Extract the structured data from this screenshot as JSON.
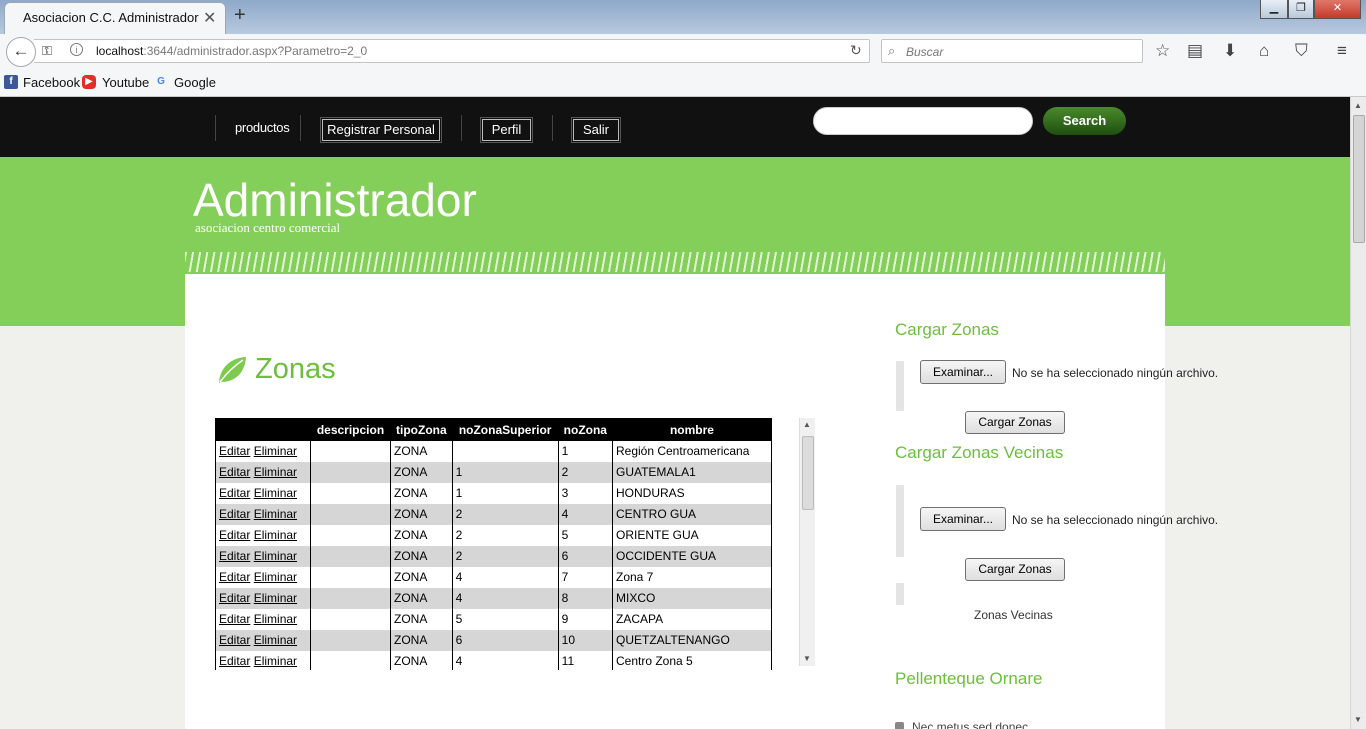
{
  "browser": {
    "tab_title": "Asociacion C.C. Administrador",
    "url_host": "localhost",
    "url_rest": ":3644/administrador.aspx?Parametro=2_0",
    "search_placeholder": "Buscar",
    "bookmarks": [
      "Facebook",
      "Youtube",
      "Google"
    ]
  },
  "nav": {
    "items": [
      {
        "label": "productos",
        "type": "link"
      },
      {
        "label": "Registrar Personal",
        "type": "button"
      },
      {
        "label": "Perfil",
        "type": "button"
      },
      {
        "label": "Salir",
        "type": "button"
      }
    ],
    "search_button": "Search"
  },
  "header": {
    "title": "Administrador",
    "subtitle": "asociacion centro comercial"
  },
  "main": {
    "section_title": "Zonas",
    "table": {
      "columns": [
        "",
        "descripcion",
        "tipoZona",
        "noZonaSuperior",
        "noZona",
        "nombre"
      ],
      "edit_label": "Editar",
      "delete_label": "Eliminar",
      "rows": [
        {
          "descripcion": "",
          "tipoZona": "ZONA",
          "noZonaSuperior": "",
          "noZona": "1",
          "nombre": "Región Centroamericana"
        },
        {
          "descripcion": "",
          "tipoZona": "ZONA",
          "noZonaSuperior": "1",
          "noZona": "2",
          "nombre": "GUATEMALA1"
        },
        {
          "descripcion": "",
          "tipoZona": "ZONA",
          "noZonaSuperior": "1",
          "noZona": "3",
          "nombre": "HONDURAS"
        },
        {
          "descripcion": "",
          "tipoZona": "ZONA",
          "noZonaSuperior": "2",
          "noZona": "4",
          "nombre": "CENTRO GUA"
        },
        {
          "descripcion": "",
          "tipoZona": "ZONA",
          "noZonaSuperior": "2",
          "noZona": "5",
          "nombre": "ORIENTE GUA"
        },
        {
          "descripcion": "",
          "tipoZona": "ZONA",
          "noZonaSuperior": "2",
          "noZona": "6",
          "nombre": "OCCIDENTE GUA"
        },
        {
          "descripcion": "",
          "tipoZona": "ZONA",
          "noZonaSuperior": "4",
          "noZona": "7",
          "nombre": "Zona 7"
        },
        {
          "descripcion": "",
          "tipoZona": "ZONA",
          "noZonaSuperior": "4",
          "noZona": "8",
          "nombre": "MIXCO"
        },
        {
          "descripcion": "",
          "tipoZona": "ZONA",
          "noZonaSuperior": "5",
          "noZona": "9",
          "nombre": "ZACAPA"
        },
        {
          "descripcion": "",
          "tipoZona": "ZONA",
          "noZonaSuperior": "6",
          "noZona": "10",
          "nombre": "QUETZALTENANGO"
        },
        {
          "descripcion": "",
          "tipoZona": "ZONA",
          "noZonaSuperior": "4",
          "noZona": "11",
          "nombre": "Centro Zona 5"
        }
      ]
    }
  },
  "sidebar": {
    "upload_zones": {
      "title": "Cargar Zonas",
      "file_button": "Examinar...",
      "file_status": "No se ha seleccionado ningún archivo.",
      "submit": "Cargar Zonas"
    },
    "upload_neighbors": {
      "title": "Cargar Zonas Vecinas",
      "file_button": "Examinar...",
      "file_status": "No se ha seleccionado ningún archivo.",
      "submit": "Cargar Zonas",
      "label": "Zonas Vecinas"
    },
    "extra_title": "Pellenteque Ornare",
    "extra_item": "Nec metus sed donec"
  },
  "colors": {
    "accent_green": "#6cbf3c",
    "banner_green": "#84cf5a",
    "nav_black": "#111111"
  }
}
